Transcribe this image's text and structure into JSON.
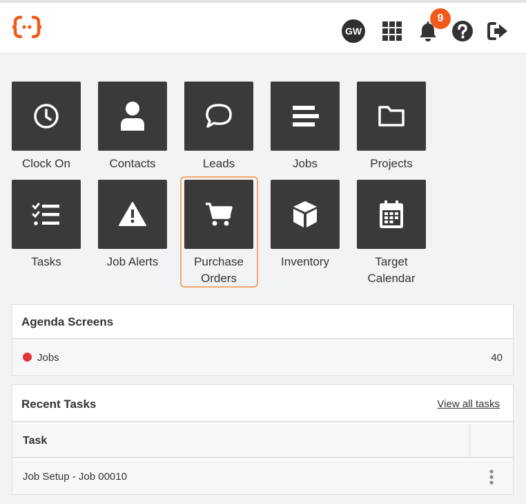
{
  "header": {
    "avatar_initials": "GW",
    "notification_count": "9",
    "icons": [
      "logo-icon",
      "apps-grid-icon",
      "bell-icon",
      "help-icon",
      "logout-icon"
    ],
    "accent_color": "#f25a1d"
  },
  "tiles": [
    {
      "label": "Clock On",
      "icon": "clock-icon"
    },
    {
      "label": "Contacts",
      "icon": "person-icon"
    },
    {
      "label": "Leads",
      "icon": "chat-bubble-icon"
    },
    {
      "label": "Jobs",
      "icon": "lines-icon"
    },
    {
      "label": "Projects",
      "icon": "folder-icon"
    },
    {
      "label": "Tasks",
      "icon": "checklist-icon"
    },
    {
      "label": "Job Alerts",
      "icon": "warning-icon"
    },
    {
      "label": "Purchase Orders",
      "label_line1": "Purchase",
      "label_line2": "Orders",
      "icon": "cart-icon"
    },
    {
      "label": "Inventory",
      "icon": "box-icon"
    },
    {
      "label": "Target Calendar",
      "label_line1": "Target",
      "label_line2": "Calendar",
      "icon": "calendar-icon"
    }
  ],
  "agenda": {
    "title": "Agenda Screens",
    "items": [
      {
        "label": "Jobs",
        "count": "40",
        "dot_color": "#e0363b"
      }
    ]
  },
  "recent_tasks": {
    "title": "Recent Tasks",
    "view_all_label": "View all tasks",
    "column_header": "Task",
    "rows": [
      {
        "task": "Job Setup - Job 00010"
      }
    ]
  }
}
